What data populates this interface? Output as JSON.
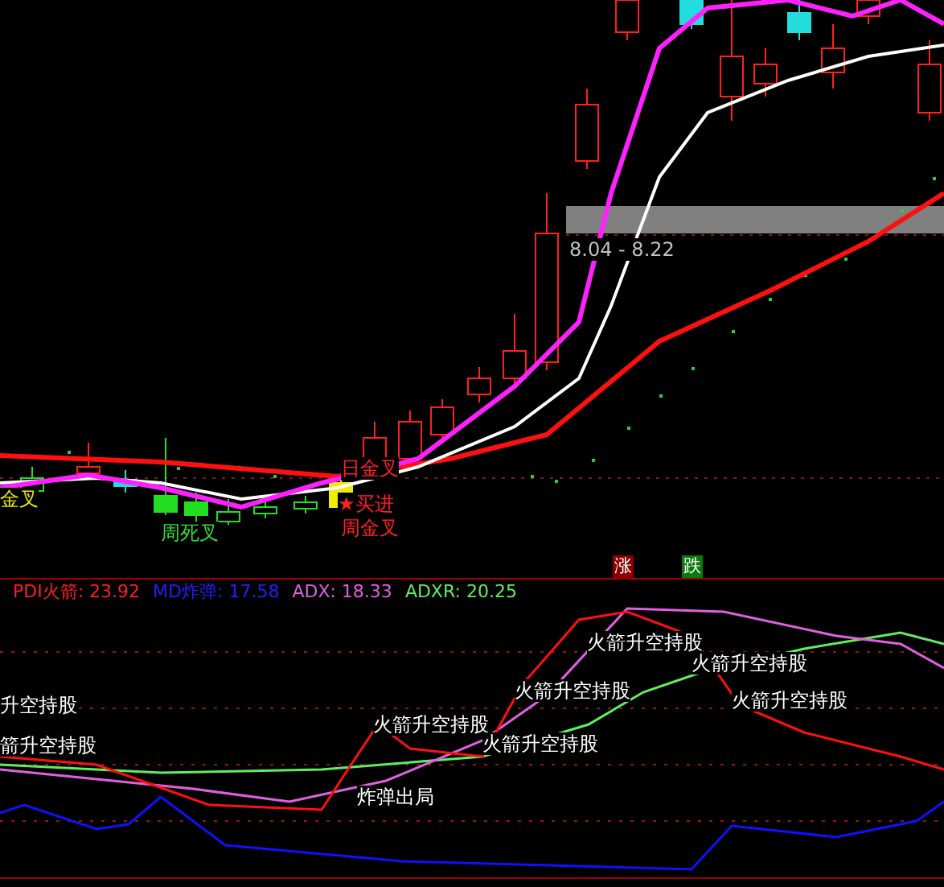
{
  "main_chart": {
    "price_range": "8.04 - 8.22",
    "signals": [
      {
        "text": "金叉",
        "color": "#e8e800"
      },
      {
        "text": "周死叉",
        "color": "#33dd33"
      },
      {
        "text": "日金叉",
        "color": "#ff2020"
      },
      {
        "text": "★买进",
        "color": "#ff2020"
      },
      {
        "text": "周金叉",
        "color": "#ff2020"
      }
    ]
  },
  "badges": [
    {
      "text": "涨",
      "kind": "up"
    },
    {
      "text": "跌",
      "kind": "down"
    }
  ],
  "indicator": {
    "readings": [
      {
        "text": "PDI火箭: 23.92",
        "color": "#ff2020"
      },
      {
        "text": "MD炸弹: 17.58",
        "color": "#2020ff"
      },
      {
        "text": "ADX: 18.33",
        "color": "#e060e0"
      },
      {
        "text": "ADXR: 20.25",
        "color": "#60ee60"
      }
    ],
    "labels": [
      "升空持股",
      "箭升空持股",
      "火箭升空持股",
      "火箭升空持股",
      "火箭升空持股",
      "火箭升空持股",
      "火箭升空持股",
      "火箭升空持股",
      "炸弹出局"
    ]
  }
}
